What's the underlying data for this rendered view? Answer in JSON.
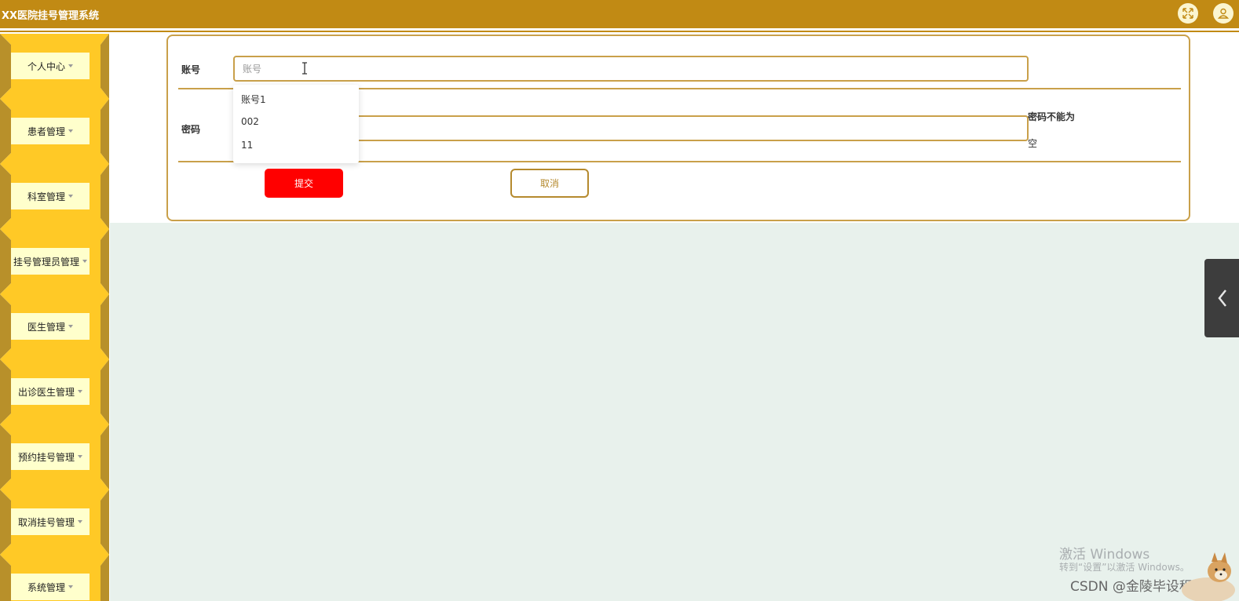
{
  "app": {
    "title": "XX医院挂号管理系统"
  },
  "header": {
    "fullscreen_icon": "fullscreen-icon",
    "user_icon": "user-icon"
  },
  "sidebar": {
    "items": [
      {
        "label": "个人中心"
      },
      {
        "label": "患者管理"
      },
      {
        "label": "科室管理"
      },
      {
        "label": "挂号管理员管理"
      },
      {
        "label": "医生管理"
      },
      {
        "label": "出诊医生管理"
      },
      {
        "label": "预约挂号管理"
      },
      {
        "label": "取消挂号管理"
      },
      {
        "label": "系统管理"
      }
    ]
  },
  "form": {
    "account_label": "账号",
    "account_placeholder": "账号",
    "account_value": "",
    "password_label": "密码",
    "password_value": "",
    "password_error_line1": "密码不能为",
    "password_error_line2": "空",
    "autocomplete": [
      "账号1",
      "002",
      "11"
    ],
    "submit_label": "提交",
    "cancel_label": "取消"
  },
  "colors": {
    "topbar": "#c18a14",
    "sidebar_gold": "#b8902a",
    "sidebar_bright": "#ffc926",
    "menu_label_bg": "#ffffcc",
    "border_gold": "#c9a04a",
    "submit_red": "#ff0000",
    "page_bg": "#e8f1ec"
  },
  "overlay": {
    "watermark_line1": "激活 Windows",
    "watermark_line2": "转到“设置”以激活 Windows。",
    "csdn": "CSDN @金陵毕设程序"
  }
}
